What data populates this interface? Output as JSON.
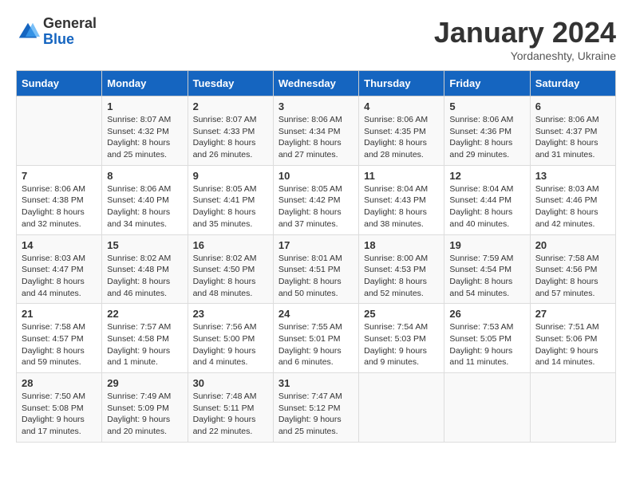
{
  "logo": {
    "general": "General",
    "blue": "Blue"
  },
  "header": {
    "month": "January 2024",
    "location": "Yordaneshty, Ukraine"
  },
  "days_of_week": [
    "Sunday",
    "Monday",
    "Tuesday",
    "Wednesday",
    "Thursday",
    "Friday",
    "Saturday"
  ],
  "weeks": [
    [
      {
        "day": "",
        "info": ""
      },
      {
        "day": "1",
        "info": "Sunrise: 8:07 AM\nSunset: 4:32 PM\nDaylight: 8 hours\nand 25 minutes."
      },
      {
        "day": "2",
        "info": "Sunrise: 8:07 AM\nSunset: 4:33 PM\nDaylight: 8 hours\nand 26 minutes."
      },
      {
        "day": "3",
        "info": "Sunrise: 8:06 AM\nSunset: 4:34 PM\nDaylight: 8 hours\nand 27 minutes."
      },
      {
        "day": "4",
        "info": "Sunrise: 8:06 AM\nSunset: 4:35 PM\nDaylight: 8 hours\nand 28 minutes."
      },
      {
        "day": "5",
        "info": "Sunrise: 8:06 AM\nSunset: 4:36 PM\nDaylight: 8 hours\nand 29 minutes."
      },
      {
        "day": "6",
        "info": "Sunrise: 8:06 AM\nSunset: 4:37 PM\nDaylight: 8 hours\nand 31 minutes."
      }
    ],
    [
      {
        "day": "7",
        "info": "Sunrise: 8:06 AM\nSunset: 4:38 PM\nDaylight: 8 hours\nand 32 minutes."
      },
      {
        "day": "8",
        "info": "Sunrise: 8:06 AM\nSunset: 4:40 PM\nDaylight: 8 hours\nand 34 minutes."
      },
      {
        "day": "9",
        "info": "Sunrise: 8:05 AM\nSunset: 4:41 PM\nDaylight: 8 hours\nand 35 minutes."
      },
      {
        "day": "10",
        "info": "Sunrise: 8:05 AM\nSunset: 4:42 PM\nDaylight: 8 hours\nand 37 minutes."
      },
      {
        "day": "11",
        "info": "Sunrise: 8:04 AM\nSunset: 4:43 PM\nDaylight: 8 hours\nand 38 minutes."
      },
      {
        "day": "12",
        "info": "Sunrise: 8:04 AM\nSunset: 4:44 PM\nDaylight: 8 hours\nand 40 minutes."
      },
      {
        "day": "13",
        "info": "Sunrise: 8:03 AM\nSunset: 4:46 PM\nDaylight: 8 hours\nand 42 minutes."
      }
    ],
    [
      {
        "day": "14",
        "info": "Sunrise: 8:03 AM\nSunset: 4:47 PM\nDaylight: 8 hours\nand 44 minutes."
      },
      {
        "day": "15",
        "info": "Sunrise: 8:02 AM\nSunset: 4:48 PM\nDaylight: 8 hours\nand 46 minutes."
      },
      {
        "day": "16",
        "info": "Sunrise: 8:02 AM\nSunset: 4:50 PM\nDaylight: 8 hours\nand 48 minutes."
      },
      {
        "day": "17",
        "info": "Sunrise: 8:01 AM\nSunset: 4:51 PM\nDaylight: 8 hours\nand 50 minutes."
      },
      {
        "day": "18",
        "info": "Sunrise: 8:00 AM\nSunset: 4:53 PM\nDaylight: 8 hours\nand 52 minutes."
      },
      {
        "day": "19",
        "info": "Sunrise: 7:59 AM\nSunset: 4:54 PM\nDaylight: 8 hours\nand 54 minutes."
      },
      {
        "day": "20",
        "info": "Sunrise: 7:58 AM\nSunset: 4:56 PM\nDaylight: 8 hours\nand 57 minutes."
      }
    ],
    [
      {
        "day": "21",
        "info": "Sunrise: 7:58 AM\nSunset: 4:57 PM\nDaylight: 8 hours\nand 59 minutes."
      },
      {
        "day": "22",
        "info": "Sunrise: 7:57 AM\nSunset: 4:58 PM\nDaylight: 9 hours\nand 1 minute."
      },
      {
        "day": "23",
        "info": "Sunrise: 7:56 AM\nSunset: 5:00 PM\nDaylight: 9 hours\nand 4 minutes."
      },
      {
        "day": "24",
        "info": "Sunrise: 7:55 AM\nSunset: 5:01 PM\nDaylight: 9 hours\nand 6 minutes."
      },
      {
        "day": "25",
        "info": "Sunrise: 7:54 AM\nSunset: 5:03 PM\nDaylight: 9 hours\nand 9 minutes."
      },
      {
        "day": "26",
        "info": "Sunrise: 7:53 AM\nSunset: 5:05 PM\nDaylight: 9 hours\nand 11 minutes."
      },
      {
        "day": "27",
        "info": "Sunrise: 7:51 AM\nSunset: 5:06 PM\nDaylight: 9 hours\nand 14 minutes."
      }
    ],
    [
      {
        "day": "28",
        "info": "Sunrise: 7:50 AM\nSunset: 5:08 PM\nDaylight: 9 hours\nand 17 minutes."
      },
      {
        "day": "29",
        "info": "Sunrise: 7:49 AM\nSunset: 5:09 PM\nDaylight: 9 hours\nand 20 minutes."
      },
      {
        "day": "30",
        "info": "Sunrise: 7:48 AM\nSunset: 5:11 PM\nDaylight: 9 hours\nand 22 minutes."
      },
      {
        "day": "31",
        "info": "Sunrise: 7:47 AM\nSunset: 5:12 PM\nDaylight: 9 hours\nand 25 minutes."
      },
      {
        "day": "",
        "info": ""
      },
      {
        "day": "",
        "info": ""
      },
      {
        "day": "",
        "info": ""
      }
    ]
  ]
}
